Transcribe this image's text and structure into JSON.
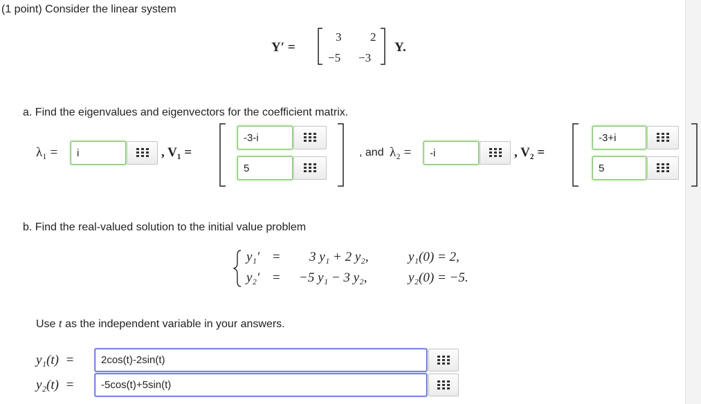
{
  "header": {
    "text": "(1 point) Consider the linear system"
  },
  "system": {
    "lhs": "Y′ =",
    "m11": "3",
    "m12": "2",
    "m21": "−5",
    "m22": "−3",
    "rhs": "Y."
  },
  "part_a": {
    "prompt": "a. Find the eigenvalues and eigenvectors for the coefficient matrix.",
    "lambda1_label": "λ₁ =",
    "lambda1_value": "i",
    "v1_label": ", V₁ =",
    "v1_top": "-3-i",
    "v1_bottom": "5",
    "and_label": ", and",
    "lambda2_label": "λ₂ =",
    "lambda2_value": "-i",
    "v2_label": ", V₂ =",
    "v2_top": "-3+i",
    "v2_bottom": "5"
  },
  "part_b": {
    "prompt": "b. Find the real-valued solution to the initial value problem",
    "eq1_lhs": "y₁′",
    "eq1_eq": "=",
    "eq1_rhs": "3 y₁ + 2 y₂,",
    "ic1": "y₁(0) = 2,",
    "eq2_lhs": "y₂′",
    "eq2_eq": "=",
    "eq2_rhs": "−5 y₁ − 3 y₂,",
    "ic2": "y₂(0) = −5.",
    "instruction_pre": "Use",
    "instruction_var": "t",
    "instruction_post": "as the independent variable in your answers.",
    "y1_label": "y₁(t)  =",
    "y1_value": "2cos(t)-2sin(t)",
    "y2_label": "y₂(t)  =",
    "y2_value": "-5cos(t)+5sin(t)"
  },
  "icons": {
    "palette": "grid-icon"
  }
}
